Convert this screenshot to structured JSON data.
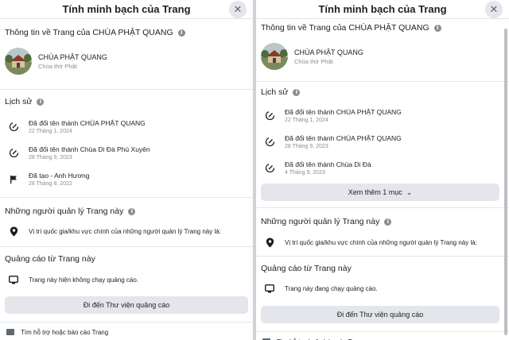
{
  "dialog": {
    "title": "Tính minh bạch của Trang",
    "close_symbol": "✕"
  },
  "page_info": {
    "section_title": "Thông tin về Trang của CHÙA PHẬT QUANG",
    "name": "CHÙA PHẬT QUANG",
    "category": "Chùa thờ Phật"
  },
  "history": {
    "section_title": "Lịch sử"
  },
  "left": {
    "history_items": [
      {
        "title": "Đã đổi tên thành CHÙA PHẬT QUANG",
        "date": "22 Tháng 1, 2024",
        "icon": "rename-icon"
      },
      {
        "title": "Đã đổi tên thành Chùa Di Đà Phú Xuyên",
        "date": "28 Tháng 9, 2023",
        "icon": "rename-icon"
      },
      {
        "title": "Đã tạo - Anh Hương",
        "date": "28 Tháng 8, 2022",
        "icon": "flag-icon"
      }
    ],
    "ads_status": "Trang này hiện không chạy quảng cáo."
  },
  "right": {
    "history_items": [
      {
        "title": "Đã đổi tên thành CHÙA PHẬT QUANG",
        "date": "22 Tháng 1, 2024",
        "icon": "rename-icon"
      },
      {
        "title": "Đã đổi tên thành CHÙA PHẬT QUANG",
        "date": "28 Tháng 9, 2023",
        "icon": "rename-icon"
      },
      {
        "title": "Đã đổi tên thành Chùa Di Đà",
        "date": "4 Tháng 9, 2023",
        "icon": "rename-icon"
      }
    ],
    "see_more": "Xem thêm 1 mục",
    "see_more_chevron": "⌄",
    "ads_status": "Trang này đang chạy quảng cáo."
  },
  "managers": {
    "section_title": "Những người quản lý Trang này",
    "location_text": "Vị trí quốc gia/khu vực chính của những người quản lý Trang này là:"
  },
  "ads": {
    "section_title": "Quảng cáo từ Trang này",
    "library_button": "Đi đến Thư viện quảng cáo"
  },
  "footer": {
    "report": "Tìm hỗ trợ hoặc báo cáo Trang"
  },
  "colors": {
    "background": "#ffffff",
    "secondary_text": "#8a8d91",
    "button_gray": "#e4e6eb"
  }
}
